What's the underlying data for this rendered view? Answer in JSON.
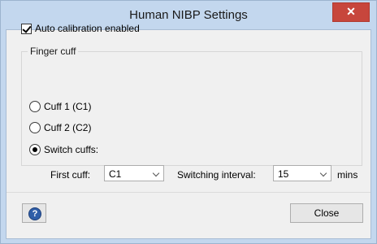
{
  "window": {
    "title": "Human NIBP Settings",
    "close_glyph": "✕"
  },
  "auto_calibration": {
    "label": "Auto calibration enabled",
    "checked": true
  },
  "finger_cuff": {
    "group_label": "Finger cuff",
    "options": [
      {
        "label": "Cuff 1 (C1)",
        "selected": false
      },
      {
        "label": "Cuff 2 (C2)",
        "selected": false
      },
      {
        "label": "Switch cuffs:",
        "selected": true
      }
    ],
    "first_cuff_label": "First cuff:",
    "first_cuff_value": "C1",
    "switching_interval_label": "Switching interval:",
    "switching_interval_value": "15",
    "switching_interval_unit": "mins"
  },
  "footer": {
    "help_icon": "help-icon",
    "help_glyph": "?",
    "close_label": "Close"
  },
  "colors": {
    "titlebar": "#c3d7ee",
    "close_button": "#c7463c",
    "client_background": "#f0f0f0",
    "help_icon": "#2f5ea8"
  }
}
